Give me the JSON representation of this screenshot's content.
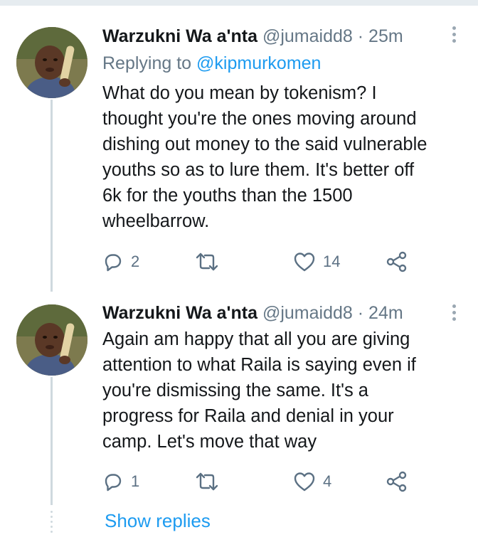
{
  "tweets": [
    {
      "name": "Warzukni Wa a'nta",
      "handle": "@jumaidd8",
      "separator": "·",
      "time": "25m",
      "replying_prefix": "Replying to ",
      "replying_to": "@kipmurkomen",
      "lines": [
        "What do you mean by tokenism? I",
        "thought you're the ones moving around",
        "dishing out money to the said vulnerable",
        "youths so as to lure them. It's better off",
        "6k for the youths than the 1500",
        "wheelbarrow."
      ],
      "replies": "2",
      "likes": "14"
    },
    {
      "name": "Warzukni Wa a'nta",
      "handle": "@jumaidd8",
      "separator": "·",
      "time": "24m",
      "lines": [
        "Again am happy that all you are giving",
        "attention to what Raila is saying even if",
        "you're dismissing the same. It's a",
        "progress for Raila and denial in your",
        "camp. Let's move that way"
      ],
      "replies": "1",
      "likes": "4"
    }
  ],
  "show_replies_label": "Show replies",
  "icons": {
    "reply": "speech-bubble-icon",
    "retweet": "retweet-arrows-icon",
    "like": "heart-icon",
    "share": "share-nodes-icon",
    "more": "vertical-dots-icon"
  },
  "colors": {
    "link": "#1d9bf0",
    "secondary_text": "#657786",
    "thread_line": "#cfd9de"
  }
}
